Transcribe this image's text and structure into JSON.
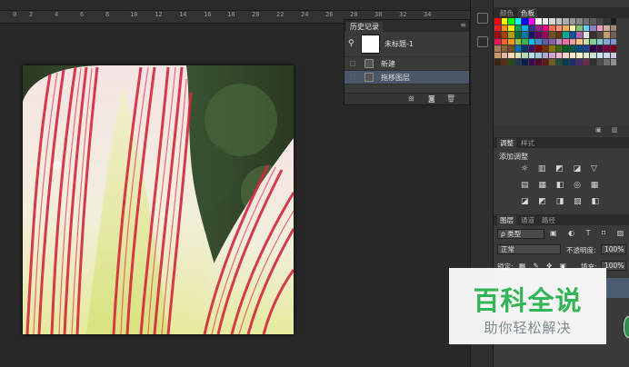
{
  "history_panel": {
    "tab_label": "历史记录",
    "snapshot_label": "未标题-1",
    "items": [
      {
        "label": "新建"
      },
      {
        "label": "拖移图层"
      }
    ]
  },
  "swatches_panel": {
    "tabs": [
      "颜色",
      "色板"
    ],
    "colors": [
      "#ff0000",
      "#ffff00",
      "#00ff00",
      "#00ffff",
      "#0000ff",
      "#ff00ff",
      "#ffffff",
      "#ebebeb",
      "#d6d6d6",
      "#c2c2c2",
      "#adadad",
      "#999999",
      "#858585",
      "#707070",
      "#5c5c5c",
      "#474747",
      "#333333",
      "#1f1f1f",
      "#ee1d24",
      "#f7941d",
      "#fff200",
      "#00a651",
      "#00aeef",
      "#2e3192",
      "#92278f",
      "#ec008c",
      "#f26c4f",
      "#f69679",
      "#fbaf5d",
      "#fff799",
      "#7cc576",
      "#6dcff6",
      "#8781bd",
      "#f49ac2",
      "#c7b299",
      "#998675",
      "#9e0b0f",
      "#a0410d",
      "#aba000",
      "#007236",
      "#0076a3",
      "#1b1464",
      "#630460",
      "#9e005d",
      "#754c24",
      "#603913",
      "#00a99d",
      "#0054a6",
      "#a864a8",
      "#e2e2e2",
      "#362f2d",
      "#534741",
      "#c69c6d",
      "#736357",
      "#ed145b",
      "#f26522",
      "#f7941d",
      "#8dc63f",
      "#39b54a",
      "#00bff3",
      "#448ccb",
      "#605ca8",
      "#855fa8",
      "#bd8cbf",
      "#f06eaa",
      "#f5989d",
      "#fdc689",
      "#c4df9b",
      "#82ca9c",
      "#7accc8",
      "#7ea7d8",
      "#8493ca",
      "#a67c52",
      "#8c6239",
      "#754c24",
      "#0072bc",
      "#003471",
      "#440e62",
      "#790000",
      "#7b2e00",
      "#827b00",
      "#406618",
      "#005e20",
      "#005952",
      "#004a80",
      "#21409a",
      "#32004b",
      "#4b0049",
      "#7b0046",
      "#7a0026",
      "#c69c6d",
      "#e5b3a0",
      "#ffd8b5",
      "#dbe5b4",
      "#b5d8b7",
      "#b4dde6",
      "#acc4e3",
      "#b0a5d1",
      "#d2a6cc",
      "#f3b6cf",
      "#f9d0d1",
      "#ffe5c7",
      "#fff5cc",
      "#e0ecc8",
      "#cce5d3",
      "#c9e5ea",
      "#c6d7ee",
      "#ccc3e1",
      "#3c2415",
      "#593012",
      "#2a4a1a",
      "#1c3b4d",
      "#0d1c4b",
      "#380a4d",
      "#4d0a2f",
      "#5e1a17",
      "#6e5a2b",
      "#1f4d3b",
      "#0a3d4d",
      "#1d2f6e",
      "#4a2a6e",
      "#6e2a4a",
      "#2e2e2e",
      "#4d4d4d",
      "#6e6e6e",
      "#8f8f8f"
    ]
  },
  "adjust_panel": {
    "tabs": [
      "调整",
      "样式"
    ],
    "title": "添加调整",
    "row1": "☼ ▥ ◩ ◪ ▽",
    "row2": "▤ ▦ ◧ ◎ ▦",
    "row3": "◪ ◩ ◨ ▨ ◧"
  },
  "layers_panel": {
    "tabs": [
      "图层",
      "通道",
      "路径"
    ],
    "filter_label": "ρ 类型",
    "filter_icons": "▣ ◐ T ⌑ ▨",
    "blend_mode": "正常",
    "opacity_label": "不透明度:",
    "opacity_value": "100%",
    "lock_label": "锁定:",
    "lock_icons": "▦ ✎ ✥ ▣",
    "fill_label": "填充:",
    "fill_value": "100%"
  },
  "watermark": {
    "main": "百科全说",
    "sub": "助你轻松解决"
  },
  "ruler": {
    "labels": [
      "0",
      "2",
      "4",
      "6",
      "8",
      "10",
      "12",
      "14",
      "16",
      "18",
      "20",
      "22",
      "24",
      "26",
      "28",
      "30",
      "32",
      "34"
    ]
  }
}
